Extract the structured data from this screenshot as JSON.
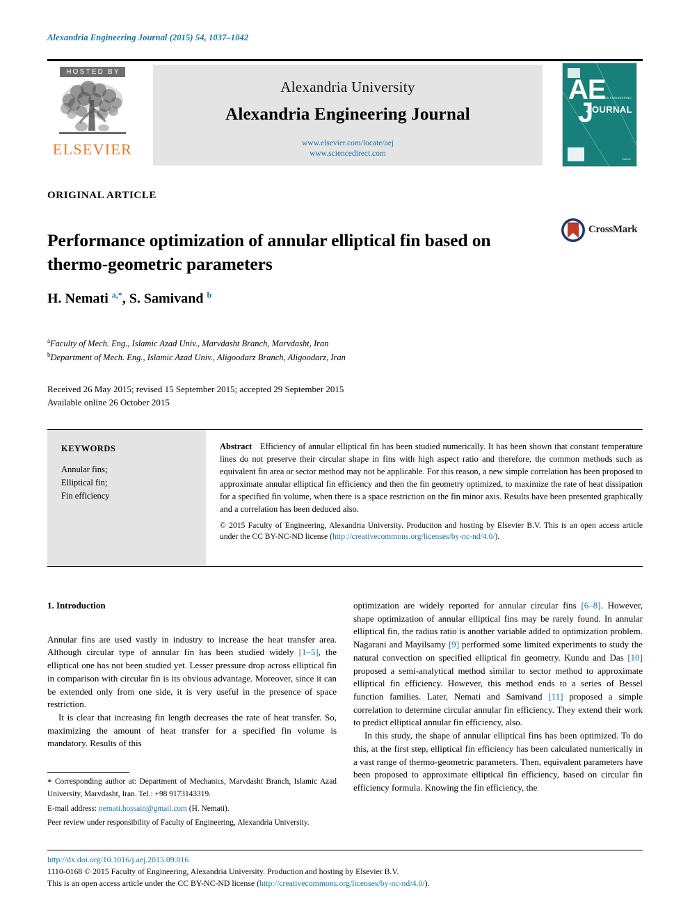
{
  "running_head": "Alexandria Engineering Journal (2015) 54, 1037–1042",
  "masthead": {
    "hosted_by": "HOSTED BY",
    "publisher": "ELSEVIER",
    "publisher_icon": "elsevier-tree-icon",
    "university": "Alexandria University",
    "journal_name": "Alexandria Engineering Journal",
    "link_locate": "www.elsevier.com/locate/aej",
    "link_sciencedirect": "www.sciencedirect.com",
    "cover": {
      "letters_line1": "AE",
      "letters_line2": "J",
      "journal_word": "OURNAL",
      "journal_initial": "J",
      "subtitle": "ALEXANDRIA ENGINEERING",
      "footer": "Elsevier"
    },
    "colors": {
      "link_blue": "#1274a0",
      "elsevier_orange": "#e87722",
      "cover_teal": "#17807a",
      "panel_gray": "#e4e4e4",
      "hosted_gray": "#6e6e6e"
    }
  },
  "article": {
    "type": "ORIGINAL ARTICLE",
    "title": "Performance optimization of annular elliptical fin based on thermo-geometric parameters",
    "crossmark_label": "CrossMark",
    "crossmark_icon": "crossmark-icon",
    "authors_html": "H. Nemati <sup>a,*</sup>, S. Samivand <sup>b</sup>",
    "affiliation_a": "Faculty of Mech. Eng., Islamic Azad Univ., Marvdasht Branch, Marvdasht, Iran",
    "affiliation_b": "Department of Mech. Eng., Islamic Azad Univ., Aligoodarz Branch, Aligoodarz, Iran",
    "dates_line1": "Received 26 May 2015; revised 15 September 2015; accepted 29 September 2015",
    "dates_line2": "Available online 26 October 2015"
  },
  "keywords": {
    "heading": "KEYWORDS",
    "items": [
      "Annular fins;",
      "Elliptical fin;",
      "Fin efficiency"
    ]
  },
  "abstract": {
    "label": "Abstract",
    "text": "Efficiency of annular elliptical fin has been studied numerically. It has been shown that constant temperature lines do not preserve their circular shape in fins with high aspect ratio and therefore, the common methods such as equivalent fin area or sector method may not be applicable. For this reason, a new simple correlation has been proposed to approximate annular elliptical fin efficiency and then the fin geometry optimized, to maximize the rate of heat dissipation for a specified fin volume, when there is a space restriction on the fin minor axis. Results have been presented graphically and a correlation has been deduced also.",
    "copyright_before": "© 2015 Faculty of Engineering, Alexandria University. Production and hosting by Elsevier B.V.  This is an open access article under the CC BY-NC-ND license (",
    "copyright_link": "http://creativecommons.org/licenses/by-nc-nd/4.0/",
    "copyright_after": ")."
  },
  "body": {
    "section_heading": "1. Introduction",
    "left_p1_a": "Annular fins are used vastly in industry to increase the heat transfer area. Although circular type of annular fin has been studied widely ",
    "left_p1_cite": "[1–5]",
    "left_p1_b": ", the elliptical one has not been studied yet. Lesser pressure drop across elliptical fin in comparison with circular fin is its obvious advantage. Moreover, since it can be extended only from one side, it is very useful in the presence of space restriction.",
    "left_p2": "It is clear that increasing fin length decreases the rate of heat transfer. So, maximizing the amount of heat transfer for a specified fin volume is mandatory. Results of this",
    "right_p1_a": "optimization are widely reported for annular circular fins ",
    "right_p1_cite1": "[6–8]",
    "right_p1_b": ". However, shape optimization of annular elliptical fins may be rarely found. In annular elliptical fin, the radius ratio is another variable added to optimization problem. Nagarani and Mayilsamy ",
    "right_p1_cite2": "[9]",
    "right_p1_c": " performed some limited experiments to study the natural convection on specified elliptical fin geometry. Kundu and Das ",
    "right_p1_cite3": "[10]",
    "right_p1_d": " proposed a semi-analytical method similar to sector method to approximate elliptical fin efficiency. However, this method ends to a series of Bessel function families. Later, Nemati and Samivand ",
    "right_p1_cite4": "[11]",
    "right_p1_e": " proposed a simple correlation to determine circular annular fin efficiency. They extend their work to predict elliptical annular fin efficiency, also.",
    "right_p2": "In this study, the shape of annular elliptical fins has been optimized. To do this, at the first step, elliptical fin efficiency has been calculated numerically in a vast range of thermo-geometric parameters. Then, equivalent parameters have been proposed to approximate elliptical fin efficiency, based on circular fin efficiency formula. Knowing the fin efficiency, the"
  },
  "footnote": {
    "star": "*",
    "corresponding": " Corresponding author at: Department of Mechanics, Marvdasht Branch, Islamic Azad University, Marvdasht, Iran. Tel.: +98 9173143319.",
    "email_label": "E-mail address: ",
    "email": "nemati.hossain@gmail.com",
    "email_after": " (H. Nemati).",
    "peer_review": "Peer review under responsibility of Faculty of Engineering, Alexandria University."
  },
  "page_footer": {
    "doi": "http://dx.doi.org/10.1016/j.aej.2015.09.016",
    "line1": "1110-0168 © 2015 Faculty of Engineering, Alexandria University. Production and hosting by Elsevier B.V.",
    "line2_before": "This is an open access article under the CC BY-NC-ND license (",
    "line2_link": "http://creativecommons.org/licenses/by-nc-nd/4.0/",
    "line2_after": ")."
  }
}
